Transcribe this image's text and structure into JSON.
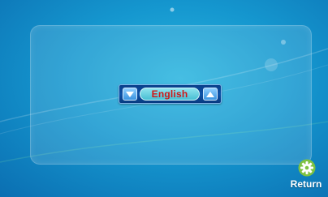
{
  "screen": {
    "background_colors": [
      "#2bb5df",
      "#1597cf",
      "#0b6fb2"
    ]
  },
  "language_selector": {
    "value": "English",
    "text_color": "#d01717",
    "down_icon": "triangle-down-icon",
    "up_icon": "triangle-up-icon"
  },
  "return_button": {
    "label": "Return",
    "icon": "gear-icon"
  }
}
